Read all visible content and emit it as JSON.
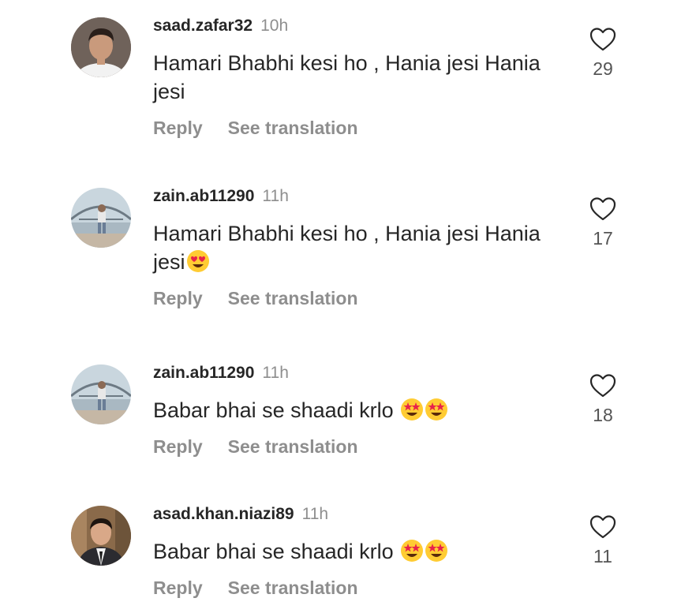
{
  "comments": [
    {
      "username": "saad.zafar32",
      "time": "10h",
      "text": "Hamari Bhabhi kesi ho , Hania jesi Hania jesi",
      "emojis": [],
      "reply": "Reply",
      "see_translation": "See translation",
      "likes": "29",
      "avatar": "photo-man-white-tshirt"
    },
    {
      "username": "zain.ab11290",
      "time": "11h",
      "text": "Hamari Bhabhi kesi ho , Hania jesi Hania jesi",
      "emojis": [
        "heart-eyes"
      ],
      "reply": "Reply",
      "see_translation": "See translation",
      "likes": "17",
      "avatar": "photo-harbour-bridge"
    },
    {
      "username": "zain.ab11290",
      "time": "11h",
      "text": "Babar bhai se shaadi krlo ",
      "emojis": [
        "star-struck",
        "star-struck"
      ],
      "reply": "Reply",
      "see_translation": "See translation",
      "likes": "18",
      "avatar": "photo-harbour-bridge"
    },
    {
      "username": "asad.khan.niazi89",
      "time": "11h",
      "text": "Babar bhai se shaadi krlo ",
      "emojis": [
        "star-struck",
        "star-struck"
      ],
      "reply": "Reply",
      "see_translation": "See translation",
      "likes": "11",
      "avatar": "photo-man-suit"
    }
  ],
  "colors": {
    "text": "#262626",
    "muted": "#8e8e8e",
    "heart_outline": "#262626"
  },
  "icons": {
    "like": "heart-outline-icon"
  }
}
